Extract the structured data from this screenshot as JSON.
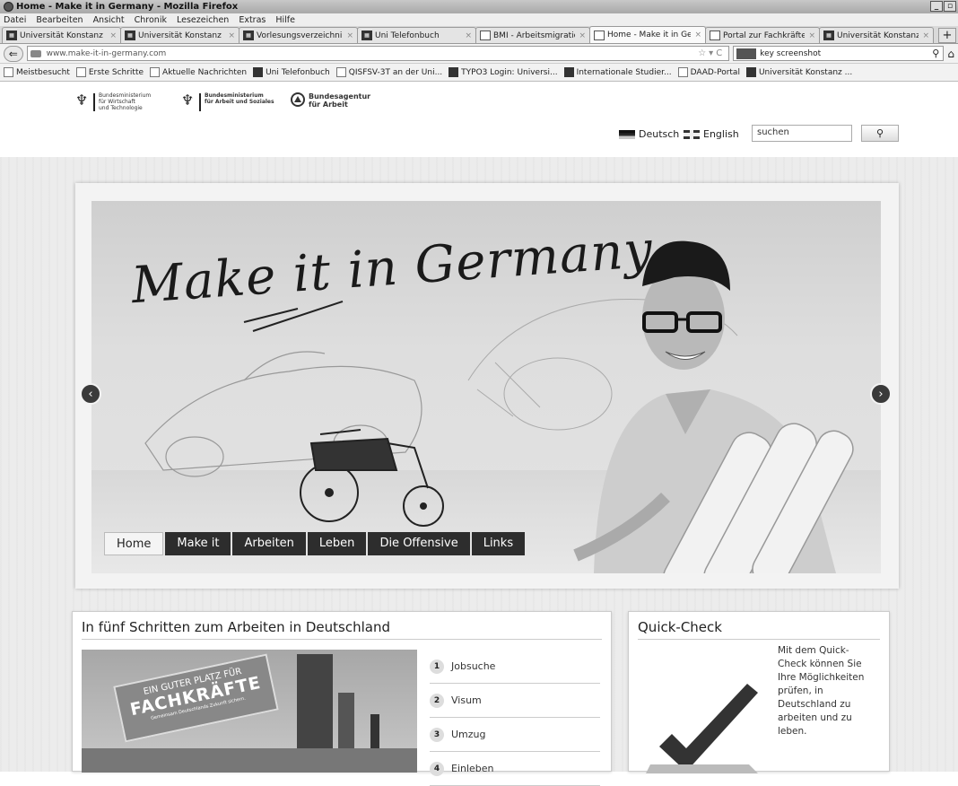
{
  "browser": {
    "window_title": "Home - Make it in Germany - Mozilla Firefox",
    "menu": [
      "Datei",
      "Bearbeiten",
      "Ansicht",
      "Chronik",
      "Lesezeichen",
      "Extras",
      "Hilfe"
    ],
    "tabs": [
      {
        "label": "Universität Konstanz |",
        "active": false
      },
      {
        "label": "Universität Konstanz |",
        "active": false
      },
      {
        "label": "Vorlesungsverzeichni...",
        "active": false
      },
      {
        "label": "Uni Telefonbuch",
        "active": false
      },
      {
        "label": "BMI - Arbeitsmigration",
        "active": false
      },
      {
        "label": "Home - Make it in Ger...",
        "active": true
      },
      {
        "label": "Portal zur Fachkräfte...",
        "active": false
      },
      {
        "label": "Universität Konstanz ...",
        "active": false
      }
    ],
    "new_tab": "+",
    "url": "www.make-it-in-germany.com",
    "search_value": "key screenshot",
    "bookmarks": [
      "Meistbesucht",
      "Erste Schritte",
      "Aktuelle Nachrichten",
      "Uni Telefonbuch",
      "QISFSV-3T an der Uni...",
      "TYPO3 Login: Universi...",
      "Internationale Studier...",
      "DAAD-Portal",
      "Universität Konstanz ..."
    ]
  },
  "site": {
    "logos": {
      "bmwi": [
        "Bundesministerium",
        "für Wirtschaft",
        "und Technologie"
      ],
      "bmas": [
        "Bundesministerium",
        "für Arbeit und Soziales"
      ],
      "ba": [
        "Bundesagentur",
        "für Arbeit"
      ]
    },
    "lang_de": "Deutsch",
    "lang_en": "English",
    "search_placeholder": "suchen",
    "hero_heading": "Make it in Germany",
    "nav": [
      "Home",
      "Make it",
      "Arbeiten",
      "Leben",
      "Die Offensive",
      "Links"
    ],
    "steps_title": "In fünf Schritten zum Arbeiten in Deutschland",
    "steps": [
      {
        "num": "1",
        "label": "Jobsuche"
      },
      {
        "num": "2",
        "label": "Visum"
      },
      {
        "num": "3",
        "label": "Umzug"
      },
      {
        "num": "4",
        "label": "Einleben"
      }
    ],
    "sign_text": [
      "EIN GUTER PLATZ FÜR",
      "FACHKRÄFTE",
      "Gemeinsam Deutschlands Zukunft sichern."
    ],
    "quickcheck_title": "Quick-Check",
    "quickcheck_text": "Mit dem Quick-Check können Sie Ihre Möglichkeiten prüfen, in Deutschland zu arbeiten und zu leben."
  }
}
